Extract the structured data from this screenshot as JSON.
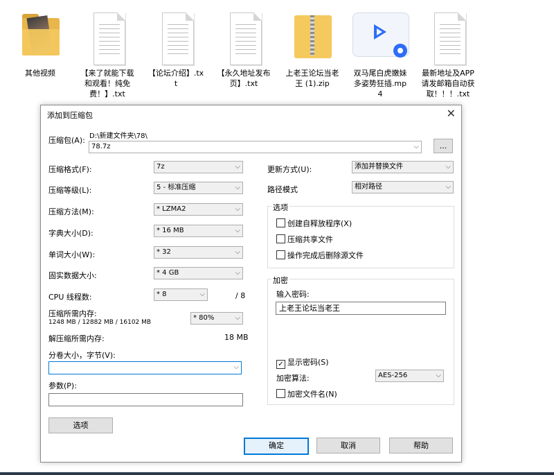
{
  "desktop": {
    "icons": [
      {
        "label": "其他视频",
        "kind": "folder"
      },
      {
        "label": "【来了就能下载和观看！纯免费！】.txt",
        "kind": "txt"
      },
      {
        "label": "【论坛介绍】.txt",
        "kind": "txt"
      },
      {
        "label": "【永久地址发布页】.txt",
        "kind": "txt"
      },
      {
        "label": "上老王论坛当老王 (1).zip",
        "kind": "zip"
      },
      {
        "label": "双马尾白虎嫩妹多姿势狂插.mp4",
        "kind": "mp4"
      },
      {
        "label": "最新地址及APP请发邮箱自动获取！！！.txt",
        "kind": "txt"
      }
    ]
  },
  "dialog": {
    "title": "添加到压缩包",
    "close_icon": "close-icon",
    "archive": {
      "label": "压缩包(A):",
      "path": "D:\\新建文件夹\\78\\",
      "value": "78.7z",
      "browse_label": "..."
    },
    "format": {
      "label": "压缩格式(F):",
      "value": "7z"
    },
    "level": {
      "label": "压缩等级(L):",
      "value": "5 - 标准压缩"
    },
    "method": {
      "label": "压缩方法(M):",
      "value": "* LZMA2"
    },
    "dict": {
      "label": "字典大小(D):",
      "value": "* 16 MB"
    },
    "word": {
      "label": "单词大小(W):",
      "value": "* 32"
    },
    "solid": {
      "label": "固实数据大小:",
      "value": "* 4 GB"
    },
    "threads": {
      "label": "CPU 线程数:",
      "value": "* 8",
      "max": "/ 8"
    },
    "mem_comp": {
      "label": "压缩所需内存:",
      "detail": "1248 MB / 12882 MB / 16102 MB",
      "value": "* 80%"
    },
    "mem_decomp": {
      "label": "解压缩所需内存:",
      "value": "18 MB"
    },
    "volume": {
      "label": "分卷大小，字节(V):",
      "value": ""
    },
    "params": {
      "label": "参数(P):",
      "value": ""
    },
    "options_button": "选项",
    "update": {
      "label": "更新方式(U):",
      "value": "添加并替换文件"
    },
    "pathmode": {
      "label": "路径模式",
      "value": "相对路径"
    },
    "options_group": {
      "title": "选项",
      "items": [
        {
          "label": "创建自释放程序(X)",
          "checked": false
        },
        {
          "label": "压缩共享文件",
          "checked": false
        },
        {
          "label": "操作完成后删除源文件",
          "checked": false
        }
      ]
    },
    "encrypt": {
      "title": "加密",
      "pwd_label": "输入密码:",
      "pwd_value": "上老王论坛当老王",
      "show_pwd": {
        "label": "显示密码(S)",
        "checked": true
      },
      "method_label": "加密算法:",
      "method_value": "AES-256",
      "encrypt_names": {
        "label": "加密文件名(N)",
        "checked": false
      }
    },
    "buttons": {
      "ok": "确定",
      "cancel": "取消",
      "help": "帮助"
    }
  }
}
